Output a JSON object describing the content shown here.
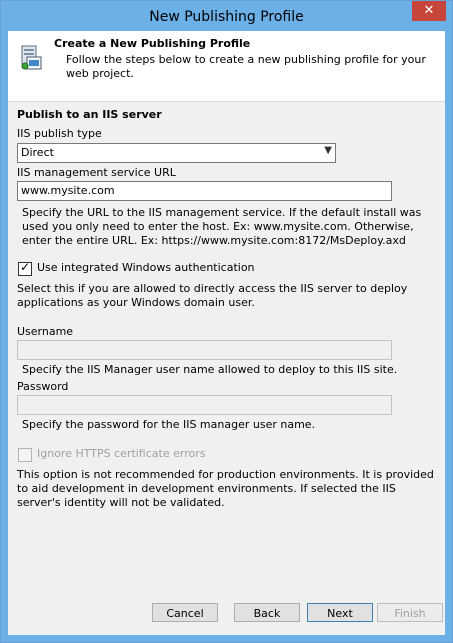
{
  "window": {
    "title": "New Publishing Profile",
    "close_glyph": "✕",
    "accent_color": "#6cb0e8"
  },
  "header": {
    "title": "Create a New Publishing Profile",
    "description": "Follow the steps below to create a new publishing profile for your web project.",
    "icon": "publishing-profile-icon"
  },
  "form": {
    "section_title": "Publish to an IIS server",
    "publish_type": {
      "label": "IIS publish type",
      "selected": "Direct"
    },
    "service_url": {
      "label": "IIS management service URL",
      "value": "www.mysite.com",
      "help": "Specify the URL to the IIS management service. If the default install was used you only need to enter the host. Ex: www.mysite.com. Otherwise, enter the entire URL. Ex: https://www.mysite.com:8172/MsDeploy.axd"
    },
    "integrated_auth": {
      "label": "Use integrated Windows authentication",
      "checked": true,
      "description": "Select this if you are allowed to directly access the IIS server to deploy applications as your Windows domain user."
    },
    "username": {
      "label": "Username",
      "value": "",
      "help": "Specify the IIS Manager user name allowed to deploy to this IIS site."
    },
    "password": {
      "label": "Password",
      "value": "",
      "help": "Specify the password for the IIS manager user name."
    },
    "ignore_https": {
      "label": "Ignore HTTPS certificate errors",
      "checked": false,
      "enabled": false,
      "description": "This option is not recommended for production environments. It is provided to aid development in development environments. If selected the IIS server's identity will not be validated."
    }
  },
  "buttons": {
    "cancel": "Cancel",
    "back": "Back",
    "next": "Next",
    "finish": "Finish"
  }
}
